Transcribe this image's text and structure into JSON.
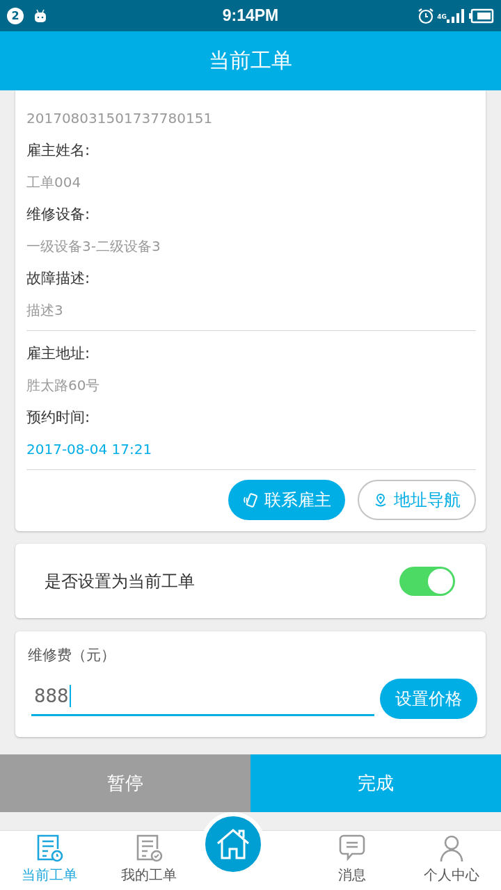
{
  "status_bar": {
    "notification_count": "2",
    "time": "9:14PM",
    "network": "4G"
  },
  "header": {
    "title": "当前工单"
  },
  "order": {
    "first_value": "201708031501737780151",
    "sections": [
      {
        "fields": [
          {
            "label": "雇主姓名:",
            "value": "工单004",
            "kind": "text"
          },
          {
            "label": "维修设备:",
            "value": "一级设备3-二级设备3",
            "kind": "text"
          },
          {
            "label": "故障描述:",
            "value": "描述3",
            "kind": "text"
          }
        ]
      },
      {
        "fields": [
          {
            "label": "雇主地址:",
            "value": "胜太路60号",
            "kind": "text"
          },
          {
            "label": "预约时间:",
            "value": "2017-08-04 17:21",
            "kind": "date"
          }
        ]
      }
    ],
    "contact_button": "联系雇主",
    "navigate_button": "地址导航"
  },
  "toggle": {
    "label": "是否设置为当前工单",
    "on": true
  },
  "fee": {
    "label": "维修费（元）",
    "value": "888",
    "button": "设置价格"
  },
  "actions": {
    "pause": "暂停",
    "finish": "完成"
  },
  "nav": [
    {
      "label": "当前工单",
      "selected": true
    },
    {
      "label": "我的工单",
      "selected": false
    },
    {
      "label": "消息",
      "selected": false
    },
    {
      "label": "个人中心",
      "selected": false
    }
  ]
}
